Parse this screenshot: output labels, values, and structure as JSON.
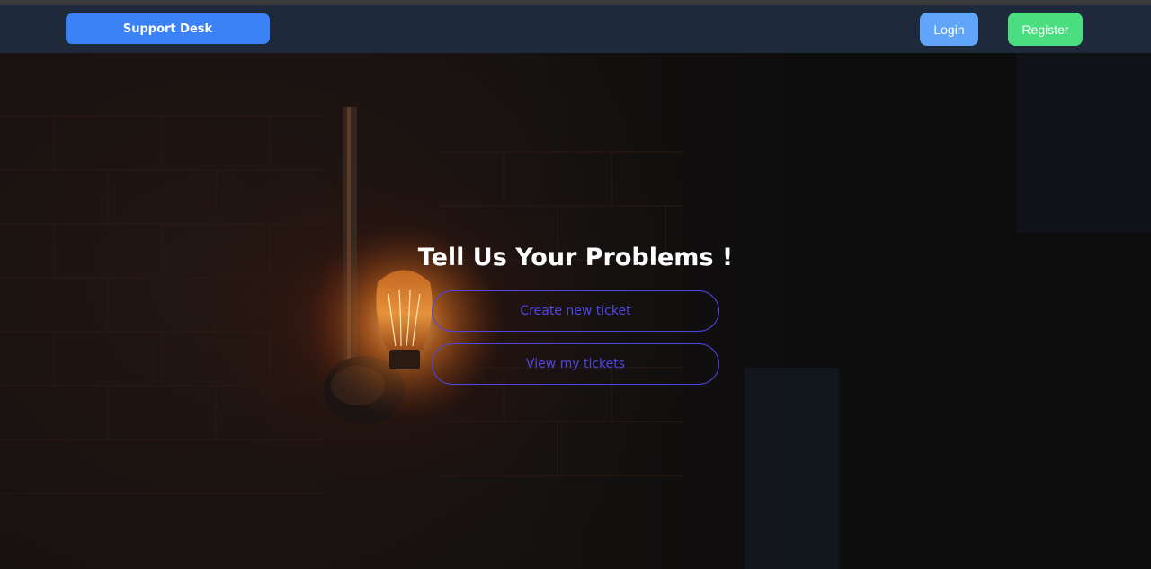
{
  "navbar": {
    "brand": "Support Desk",
    "login_label": "Login",
    "register_label": "Register"
  },
  "hero": {
    "headline": "Tell Us Your Problems !",
    "create_ticket_label": "Create new ticket",
    "view_tickets_label": "View my tickets"
  },
  "colors": {
    "navbar_bg": "#1e293b",
    "brand_bg": "#3b82f6",
    "login_bg": "#60a5fa",
    "register_bg": "#4ade80",
    "pill_accent": "#4f46e5"
  }
}
